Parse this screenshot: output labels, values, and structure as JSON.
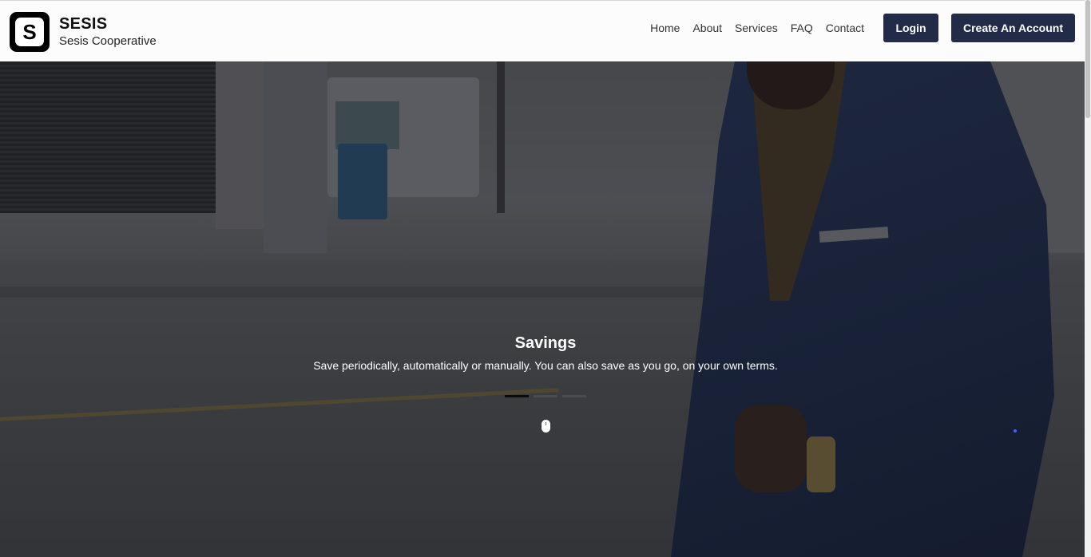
{
  "brand": {
    "logo_letter": "S",
    "name": "SESIS",
    "subtitle": "Sesis Cooperative"
  },
  "nav": {
    "links": [
      "Home",
      "About",
      "Services",
      "FAQ",
      "Contact"
    ],
    "login_label": "Login",
    "create_account_label": "Create An Account"
  },
  "hero": {
    "slide_title": "Savings",
    "slide_text": "Save periodically, automatically or manually. You can also save as you go, on your own terms.",
    "slide_count": 3,
    "active_slide": 1,
    "scroll_icon": "mouse-icon"
  },
  "colors": {
    "header_bg": "#fcfcfd",
    "button_bg": "#222c48",
    "button_text": "#ffffff",
    "caption_text": "#ffffff"
  }
}
